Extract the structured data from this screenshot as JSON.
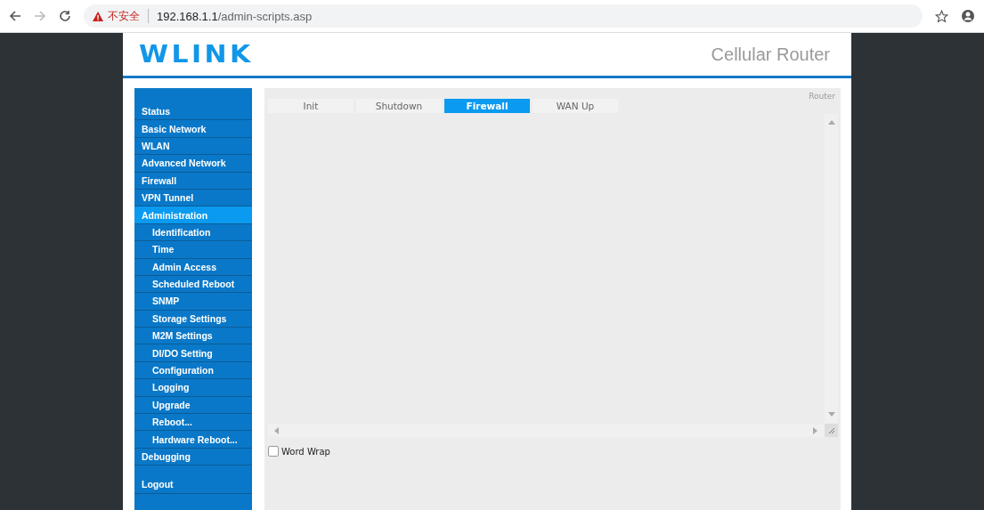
{
  "browser": {
    "warning": "不安全",
    "url_host": "192.168.1.1",
    "url_path": "/admin-scripts.asp"
  },
  "header": {
    "logo": "WLINK",
    "title": "Cellular Router"
  },
  "sidebar": {
    "items": [
      {
        "label": "Status",
        "selected": false
      },
      {
        "label": "Basic Network",
        "selected": false
      },
      {
        "label": "WLAN",
        "selected": false
      },
      {
        "label": "Advanced Network",
        "selected": false
      },
      {
        "label": "Firewall",
        "selected": false
      },
      {
        "label": "VPN Tunnel",
        "selected": false
      },
      {
        "label": "Administration",
        "selected": true,
        "children": [
          {
            "label": "Identification",
            "selected": false
          },
          {
            "label": "Time",
            "selected": false
          },
          {
            "label": "Admin Access",
            "selected": false
          },
          {
            "label": "Scheduled Reboot",
            "selected": false
          },
          {
            "label": "SNMP",
            "selected": false
          },
          {
            "label": "Storage Settings",
            "selected": false
          },
          {
            "label": "M2M Settings",
            "selected": false
          },
          {
            "label": "DI/DO Setting",
            "selected": false
          },
          {
            "label": "Configuration",
            "selected": false
          },
          {
            "label": "Logging",
            "selected": false
          },
          {
            "label": "Upgrade",
            "selected": false
          },
          {
            "label": "Reboot...",
            "selected": false
          },
          {
            "label": "Hardware Reboot...",
            "selected": false
          }
        ]
      },
      {
        "label": "Debugging",
        "selected": false
      }
    ],
    "logout": "Logout"
  },
  "panel": {
    "corner_label": "Router",
    "tabs": [
      {
        "label": "Init",
        "selected": false
      },
      {
        "label": "Shutdown",
        "selected": false
      },
      {
        "label": "Firewall",
        "selected": true
      },
      {
        "label": "WAN Up",
        "selected": false
      }
    ],
    "word_wrap": {
      "label": "Word Wrap",
      "checked": false
    }
  }
}
